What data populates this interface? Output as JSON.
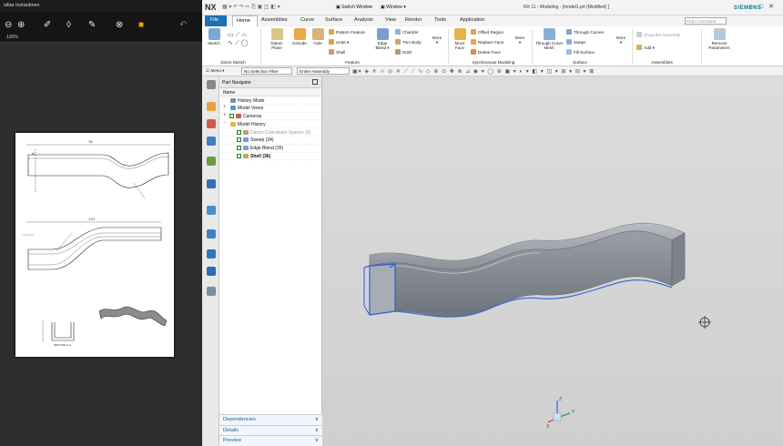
{
  "left_viewer": {
    "title": "siltar instantinex",
    "zoom": "130%",
    "toolbar_icons": [
      "zoom-out-icon",
      "zoom-in-icon",
      "drop-icon",
      "brush-icon",
      "pen-icon",
      "stamp-icon",
      "highlighter-icon",
      "undo-icon"
    ],
    "drawing": {
      "dim_top": "76",
      "dim_mid": "170",
      "section_label": "SECTION A-A",
      "label_a": "A"
    }
  },
  "nx": {
    "logo": "NX",
    "switch_window": "Switch Window",
    "window_menu": "Window",
    "title": "NX 11 - Modeling - [model1.prt (Modified) ]",
    "brand": "SIEMENS",
    "search_placeholder": "Find a Command",
    "file_tab": "File",
    "tabs": [
      "Home",
      "Assemblies",
      "Curve",
      "Surface",
      "Analysis",
      "View",
      "Render",
      "Tools",
      "Application"
    ],
    "ribbon": {
      "sketch": "Sketch",
      "direct_sketch": "Direct Sketch",
      "datum_plane": "Datum Plane",
      "extrude": "Extrude",
      "hole": "Hole",
      "pattern_feature": "Pattern Feature",
      "unite": "Unite",
      "shell": "Shell",
      "edge_blend": "Edge Blend",
      "chamfer": "Chamfer",
      "trim_body": "Trim Body",
      "draft": "Draft",
      "more": "More",
      "feature": "Feature",
      "move_face": "Move Face",
      "offset_region": "Offset Region",
      "replace_face": "Replace Face",
      "delete_face": "Delete Face",
      "sync_modeling": "Synchronous Modeling",
      "through_curve_mesh": "Through Curve Mesh",
      "through_curves": "Through Curves",
      "swept": "Swept",
      "fill_surface": "Fill Surface",
      "surface": "Surface",
      "show_assembly": "Show the Assembly",
      "add": "Add",
      "assemblies": "Assemblies",
      "remove_parameters": "Remove Parameters"
    },
    "selection_bar": {
      "menu": "Menu",
      "filter": "No Selection Filter",
      "scope": "Entire Assembly"
    },
    "part_navigator": {
      "title": "Part Navigator",
      "column": "Name",
      "rows": [
        {
          "label": "History Mode"
        },
        {
          "label": "Model Views"
        },
        {
          "label": "Cameras"
        },
        {
          "label": "Model History"
        },
        {
          "label": "Datum Coordinate System (0)"
        },
        {
          "label": "Sweep (34)"
        },
        {
          "label": "Edge Blend (35)"
        },
        {
          "label": "Shell (36)"
        }
      ],
      "footer": [
        "Dependencies",
        "Details",
        "Preview"
      ]
    },
    "viewport": {
      "axis_x": "X",
      "axis_y": "Y",
      "axis_z": "Z"
    }
  }
}
